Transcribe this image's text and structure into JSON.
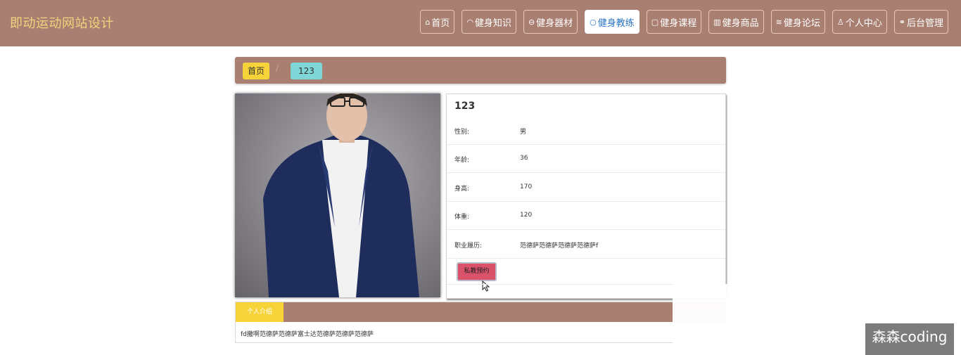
{
  "app": {
    "title": "即动运动网站设计"
  },
  "nav": {
    "items": [
      {
        "icon": "⌂",
        "label": "首页"
      },
      {
        "icon": "◠",
        "label": "健身知识"
      },
      {
        "icon": "⊖",
        "label": "健身器材"
      },
      {
        "icon": "○",
        "label": "健身教练",
        "active": true
      },
      {
        "icon": "▢",
        "label": "健身课程"
      },
      {
        "icon": "▥",
        "label": "健身商品"
      },
      {
        "icon": "≋",
        "label": "健身论坛"
      },
      {
        "icon": "♙",
        "label": "个人中心"
      },
      {
        "icon": "⚭",
        "label": "后台管理"
      }
    ]
  },
  "breadcrumb": {
    "home": "首页",
    "separator": "/",
    "current": "123"
  },
  "coach": {
    "name": "123",
    "fields": [
      {
        "label": "性别:",
        "value": "男"
      },
      {
        "label": "年龄:",
        "value": "36"
      },
      {
        "label": "身高:",
        "value": "170"
      },
      {
        "label": "体重:",
        "value": "120"
      },
      {
        "label": "职业履历:",
        "value": "范德萨范德萨范德萨范德萨f"
      }
    ],
    "book_button": "私教预约"
  },
  "intro": {
    "tab": "个人介绍",
    "text": "fd撒啊范德萨范德萨富士达范德萨范德萨范德萨"
  },
  "watermark": "森森coding",
  "colors": {
    "primary": "#a97f72",
    "brand_text": "#f3d27c",
    "highlight": "#f7d33a",
    "teal": "#7ed6d6",
    "book": "#d9526a"
  },
  "icons": [
    "home-icon",
    "knowledge-icon",
    "equipment-icon",
    "coach-icon",
    "course-icon",
    "goods-icon",
    "forum-icon",
    "user-icon",
    "admin-link-icon"
  ]
}
